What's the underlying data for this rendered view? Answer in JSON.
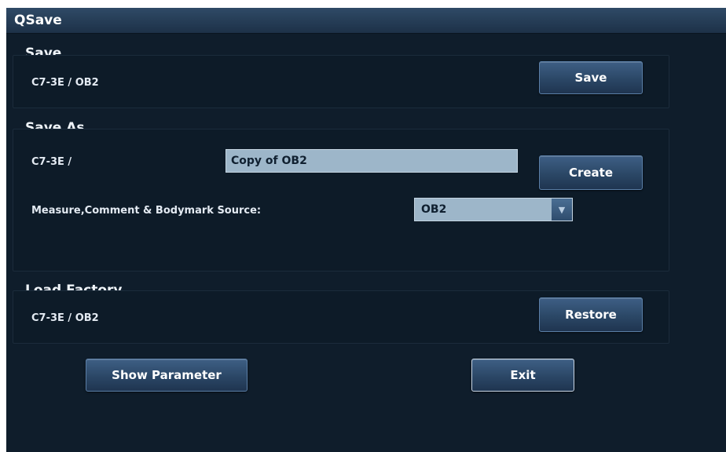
{
  "window": {
    "title": "QSave"
  },
  "save": {
    "title": "Save",
    "probe_exam": "C7-3E  /  OB2",
    "button_label": "Save"
  },
  "save_as": {
    "title": "Save As",
    "probe_prefix": "C7-3E  /",
    "name_value": "Copy of OB2",
    "create_label": "Create",
    "source_label": "Measure,Comment & Bodymark Source:",
    "source_value": "OB2",
    "arrow_icon": "chevron-down-icon"
  },
  "load_factory": {
    "title": "Load Factory",
    "probe_exam": "C7-3E  /  OB2",
    "restore_label": "Restore"
  },
  "footer": {
    "show_parameter_label": "Show Parameter",
    "exit_label": "Exit"
  }
}
